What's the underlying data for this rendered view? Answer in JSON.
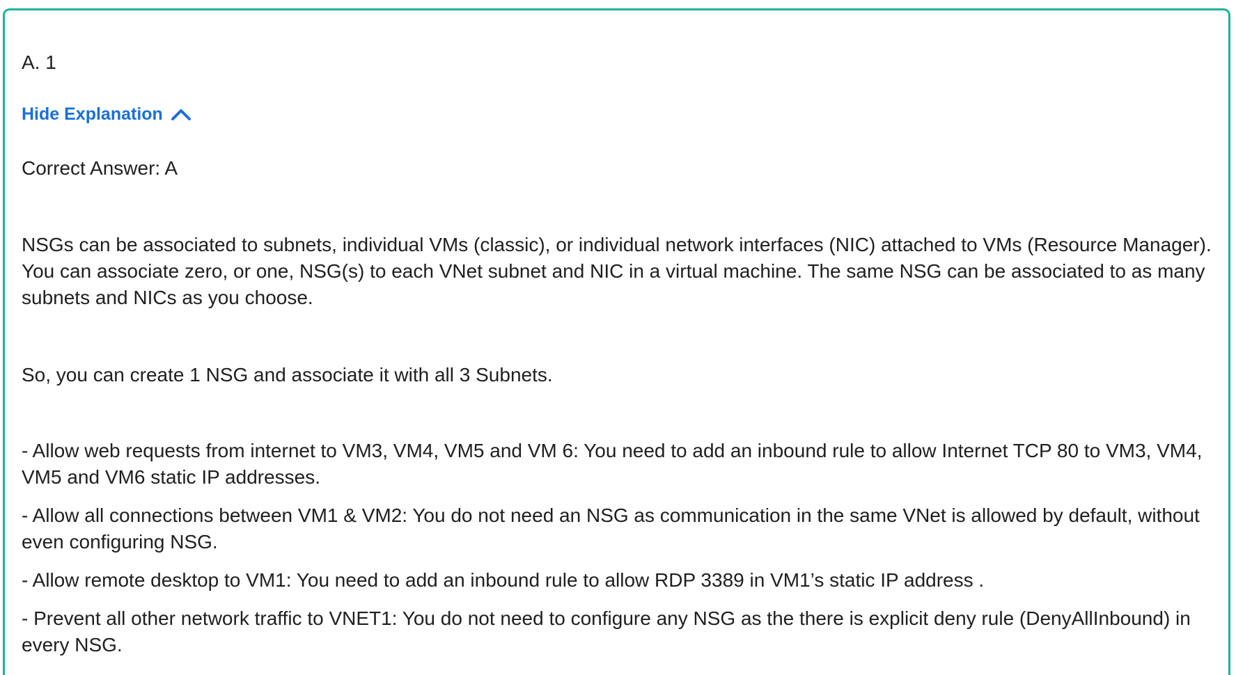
{
  "question": {
    "selected_option": "A. 1",
    "toggle_label": "Hide Explanation",
    "toggle_icon": "chevron-up-icon",
    "accent_color": "#1a6fd8",
    "border_color": "#19b39b"
  },
  "explanation": {
    "correct_answer": "Correct Answer: A",
    "paragraph_1": "NSGs can be associated to subnets, individual VMs (classic), or individual network interfaces (NIC) attached to VMs (Resource Manager). You can associate zero, or one, NSG(s) to each VNet subnet and NIC in a virtual machine. The same NSG can be associated to as many subnets and NICs as you choose.",
    "paragraph_2": "So, you can create 1 NSG and associate it with all 3 Subnets.",
    "bullets": [
      "- Allow web requests from internet to VM3, VM4, VM5 and VM 6: You need to add an inbound rule to allow Internet TCP 80 to VM3, VM4, VM5 and VM6 static IP addresses.",
      "- Allow all connections between VM1 & VM2: You do not need an NSG as communication in the same VNet is allowed by default, without even configuring NSG.",
      "- Allow remote desktop to VM1: You need to add an inbound rule to allow RDP 3389 in VM1’s static IP address .",
      "- Prevent all other network traffic to VNET1: You do not need to configure any NSG as the there is explicit deny rule (DenyAllInbound) in every NSG."
    ]
  }
}
